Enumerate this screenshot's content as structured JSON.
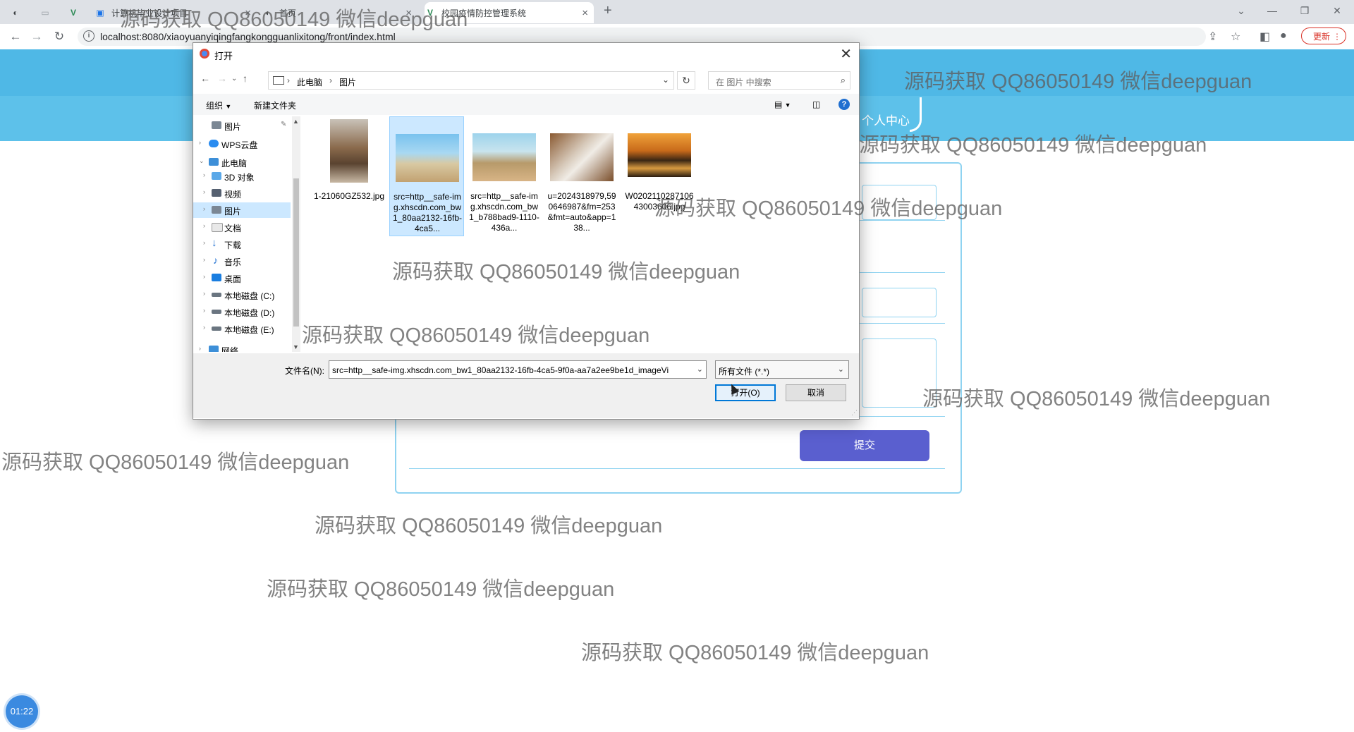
{
  "browser": {
    "tabs": [
      {
        "label": "计算机毕业设计项目"
      },
      {
        "label": "首页"
      },
      {
        "label": "校园疫情防控管理系统"
      }
    ],
    "url": "localhost:8080/xiaoyuanyiqingfangkongguanlixitong/front/index.html",
    "update_label": "更新"
  },
  "page": {
    "nav_item": "个人中心",
    "submit_label": "提交",
    "timer": "01:22"
  },
  "dialog": {
    "title": "打开",
    "breadcrumb": [
      "此电脑",
      "图片"
    ],
    "search_placeholder": "在 图片 中搜索",
    "toolbar": {
      "organize": "组织",
      "new_folder": "新建文件夹"
    },
    "tree": [
      {
        "label": "图片"
      },
      {
        "label": "WPS云盘"
      },
      {
        "label": "此电脑"
      },
      {
        "label": "3D 对象"
      },
      {
        "label": "视频"
      },
      {
        "label": "图片"
      },
      {
        "label": "文档"
      },
      {
        "label": "下载"
      },
      {
        "label": "音乐"
      },
      {
        "label": "桌面"
      },
      {
        "label": "本地磁盘 (C:)"
      },
      {
        "label": "本地磁盘 (D:)"
      },
      {
        "label": "本地磁盘 (E:)"
      },
      {
        "label": "网络"
      }
    ],
    "files": [
      {
        "name": "1-21060GZ532.jpg"
      },
      {
        "name": "src=http__safe-img.xhscdn.com_bw1_80aa2132-16fb-4ca5..."
      },
      {
        "name": "src=http__safe-img.xhscdn.com_bw1_b788bad9-1110-436a..."
      },
      {
        "name": "u=2024318979,590646987&fm=253&fmt=auto&app=138..."
      },
      {
        "name": "W020211028710643003606.jpg"
      }
    ],
    "filename_label": "文件名(N):",
    "filename_value": "src=http__safe-img.xhscdn.com_bw1_80aa2132-16fb-4ca5-9f0a-aa7a2ee9be1d_imageVi",
    "filetype_value": "所有文件 (*.*)",
    "open_label": "打开(O)",
    "cancel_label": "取消"
  },
  "watermark_text": "源码获取 QQ86050149 微信deepguan"
}
